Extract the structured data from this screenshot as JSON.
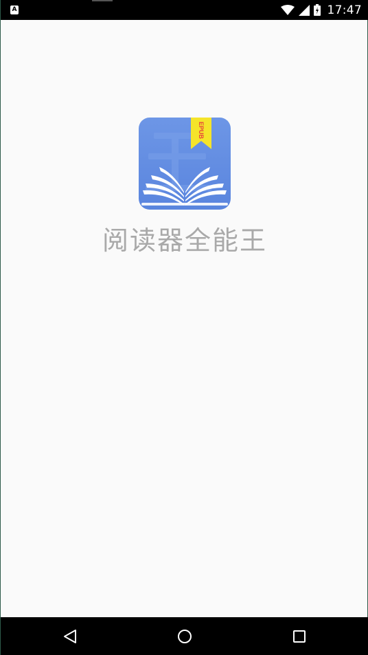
{
  "status_bar": {
    "left_icon": "A",
    "time": "17:47",
    "icons": [
      "wifi-icon",
      "cell-signal-icon",
      "battery-icon"
    ]
  },
  "splash": {
    "app_name": "阅读器全能王",
    "icon": {
      "name": "app-logo-icon",
      "ribbon_text": "EPUB",
      "colors": {
        "background": "#6490e4",
        "ribbon": "#f5e42a",
        "ribbon_text": "#e8463a",
        "book": "#ffffff"
      }
    }
  },
  "nav_bar": {
    "buttons": [
      "back-icon",
      "home-icon",
      "recents-icon"
    ]
  }
}
